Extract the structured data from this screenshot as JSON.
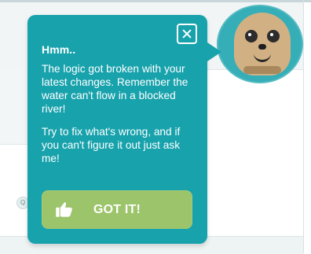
{
  "tooltip": {
    "close_label": "×",
    "title": "Hmm..",
    "paragraph_1": "The logic got broken with your latest changes. Remember the water can't flow in a blocked river!",
    "paragraph_2": "Try to fix what's wrong, and if you can't figure it out just ask me!",
    "button_label": "GOT IT!",
    "icons": {
      "close": "close-icon",
      "thumbs_up": "thumbs-up-icon"
    }
  },
  "mascot": {
    "character": "meerkat"
  },
  "colors": {
    "tooltip_background": "#17a2ac",
    "button_background": "#9cc46a",
    "mascot_background": "#35aeb7",
    "text": "#ffffff"
  }
}
